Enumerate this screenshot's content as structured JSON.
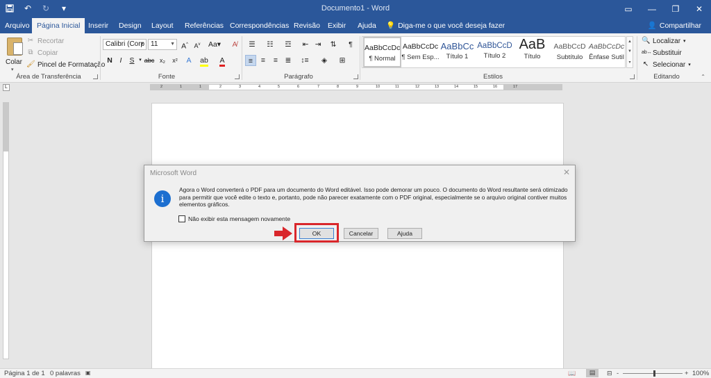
{
  "titlebar": {
    "title": "Documento1 - Word",
    "qat": [
      "save-icon",
      "undo-icon",
      "redo-icon",
      "customize-icon"
    ],
    "window_controls": [
      "ribbon-options-icon",
      "minimize-icon",
      "restore-icon",
      "close-icon"
    ]
  },
  "tabs": [
    "Arquivo",
    "Página Inicial",
    "Inserir",
    "Design",
    "Layout",
    "Referências",
    "Correspondências",
    "Revisão",
    "Exibir",
    "Ajuda"
  ],
  "active_tab": "Página Inicial",
  "tell_me": "Diga-me o que você deseja fazer",
  "share": "Compartilhar",
  "ribbon": {
    "clipboard": {
      "paste": "Colar",
      "cut": "Recortar",
      "copy": "Copiar",
      "format_painter": "Pincel de Formatação",
      "label": "Área de Transferência"
    },
    "font": {
      "family": "Calibri (Corp",
      "size": "11",
      "grow": "A",
      "shrink": "A",
      "case": "Aa",
      "bold": "N",
      "italic": "I",
      "underline": "S",
      "strike": "abc",
      "subscript": "x₂",
      "superscript": "x²",
      "label": "Fonte"
    },
    "paragraph": {
      "pilcrow": "¶",
      "label": "Parágrafo"
    },
    "styles": {
      "items": [
        {
          "preview": "AaBbCcDc",
          "name": "¶ Normal"
        },
        {
          "preview": "AaBbCcDc",
          "name": "¶ Sem Esp..."
        },
        {
          "preview": "AaBbCc",
          "name": "Título 1"
        },
        {
          "preview": "AaBbCcD",
          "name": "Título 2"
        },
        {
          "preview": "AaB",
          "name": "Título"
        },
        {
          "preview": "AaBbCcD",
          "name": "Subtítulo"
        },
        {
          "preview": "AaBbCcDc",
          "name": "Ênfase Sutil"
        }
      ],
      "label": "Estilos"
    },
    "editing": {
      "find": "Localizar",
      "replace": "Substituir",
      "select": "Selecionar",
      "label": "Editando"
    }
  },
  "ruler": {
    "corner": "L",
    "marks": [
      "2",
      "1",
      "1",
      "2",
      "3",
      "4",
      "5",
      "6",
      "7",
      "8",
      "9",
      "10",
      "11",
      "12",
      "13",
      "14",
      "15",
      "16",
      "17"
    ]
  },
  "dialog": {
    "title": "Microsoft Word",
    "close": "✕",
    "message": "Agora o Word converterá o PDF para um documento do Word editável. Isso pode demorar um pouco. O documento do Word resultante será otimizado para permitir que você edite o texto e, portanto, pode não parecer exatamente com o PDF original, especialmente se o arquivo original contiver muitos elementos gráficos.",
    "checkbox_label": "Não exibir esta mensagem novamente",
    "checkbox_checked": false,
    "ok": "OK",
    "cancel": "Cancelar",
    "help": "Ajuda",
    "highlight_color": "#d9262b"
  },
  "statusbar": {
    "page": "Página 1 de 1",
    "words": "0 palavras",
    "zoom": "100%",
    "zoom_minus": "-",
    "zoom_plus": "+"
  },
  "colors": {
    "brand": "#2b579a",
    "ribbon_bg": "#f3f3f3",
    "highlight": "#d9262b",
    "info_icon": "#1c6fd0"
  }
}
